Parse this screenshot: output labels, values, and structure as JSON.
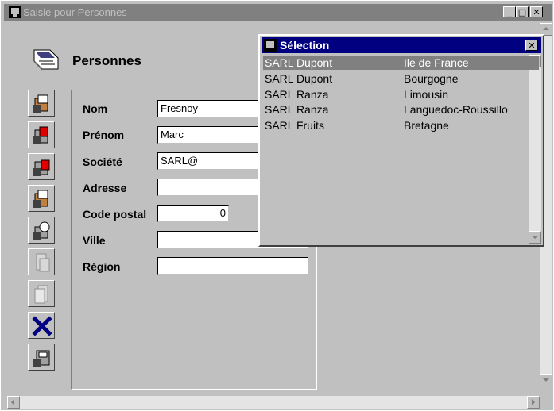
{
  "window": {
    "title": "Saisie pour  Personnes",
    "minimize_glyph": "_",
    "maximize_glyph": "□",
    "close_glyph": "✕"
  },
  "form": {
    "title": "Personnes",
    "fields": [
      {
        "label": "Nom",
        "value": "Fresnoy"
      },
      {
        "label": "Prénom",
        "value": "Marc"
      },
      {
        "label": "Société",
        "value": "SARL@"
      },
      {
        "label": "Adresse",
        "value": ""
      },
      {
        "label": "Code postal",
        "value": "0"
      },
      {
        "label": "Ville",
        "value": ""
      },
      {
        "label": "Région",
        "value": ""
      }
    ]
  },
  "toolbar": {
    "buttons": [
      {
        "icon": "first-record-icon"
      },
      {
        "icon": "previous-record-icon"
      },
      {
        "icon": "next-record-icon"
      },
      {
        "icon": "last-record-icon"
      },
      {
        "icon": "search-record-icon"
      },
      {
        "icon": "new-record-icon"
      },
      {
        "icon": "copy-record-icon"
      },
      {
        "icon": "delete-icon"
      },
      {
        "icon": "save-icon"
      }
    ]
  },
  "selection": {
    "title": "Sélection",
    "close_glyph": "✕",
    "rows": [
      {
        "company": "SARL Dupont",
        "region": "Ile de France",
        "selected": true
      },
      {
        "company": "SARL Dupont",
        "region": "Bourgogne",
        "selected": false
      },
      {
        "company": "SARL Ranza",
        "region": "Limousin",
        "selected": false
      },
      {
        "company": "SARL Ranza",
        "region": "Languedoc-Roussillo",
        "selected": false
      },
      {
        "company": "SARL Fruits",
        "region": "Bretagne",
        "selected": false
      }
    ]
  },
  "colors": {
    "window_bg": "#c0c0c0",
    "inactive_title": "#808080",
    "active_title": "#000080",
    "selection_highlight": "#808080",
    "delete_icon": "#000080"
  }
}
